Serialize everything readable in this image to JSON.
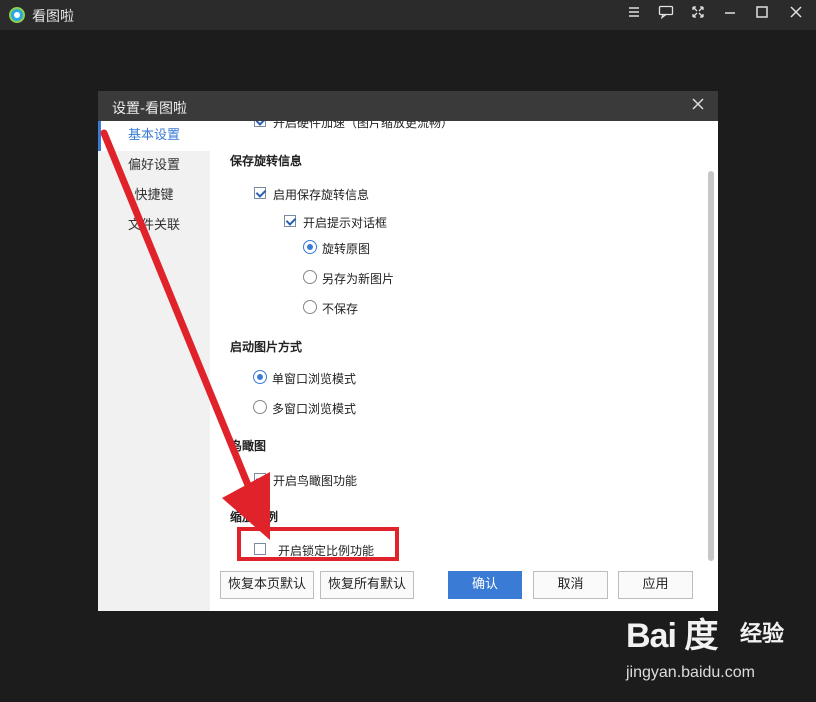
{
  "app": {
    "title": "看图啦",
    "controls": [
      "menu-icon",
      "feedback-icon",
      "fullscreen-icon",
      "minimize-icon",
      "maximize-icon",
      "close-icon"
    ]
  },
  "dialog": {
    "title": "设置-看图啦",
    "nav": [
      {
        "label": "基本设置",
        "active": true
      },
      {
        "label": "偏好设置",
        "active": false
      },
      {
        "label": "快捷键",
        "active": false
      },
      {
        "label": "文件关联",
        "active": false
      }
    ],
    "partial_option": {
      "label": "开启硬件加速（图片缩放更流畅）",
      "checked": true
    },
    "sections": {
      "rotate": {
        "title": "保存旋转信息",
        "enable": {
          "label": "启用保存旋转信息",
          "checked": true
        },
        "prompt": {
          "label": "开启提示对话框",
          "checked": true
        },
        "radios": [
          {
            "label": "旋转原图",
            "checked": true
          },
          {
            "label": "另存为新图片",
            "checked": false
          },
          {
            "label": "不保存",
            "checked": false
          }
        ]
      },
      "launch": {
        "title": "启动图片方式",
        "radios": [
          {
            "label": "单窗口浏览模式",
            "checked": true
          },
          {
            "label": "多窗口浏览模式",
            "checked": false
          }
        ]
      },
      "birdview": {
        "title": "鸟瞰图",
        "option": {
          "label": "开启鸟瞰图功能",
          "checked": true
        }
      },
      "ratio": {
        "title": "缩放比例",
        "option": {
          "label": "开启锁定比例功能",
          "checked": false
        }
      }
    },
    "buttons": {
      "restore_page": "恢复本页默认",
      "restore_all": "恢复所有默认",
      "ok": "确认",
      "cancel": "取消",
      "apply": "应用"
    }
  },
  "annotation": {
    "color": "#e0222a"
  },
  "watermark": {
    "logo": "Bai 度",
    "brand": "经验",
    "url": "jingyan.baidu.com"
  }
}
